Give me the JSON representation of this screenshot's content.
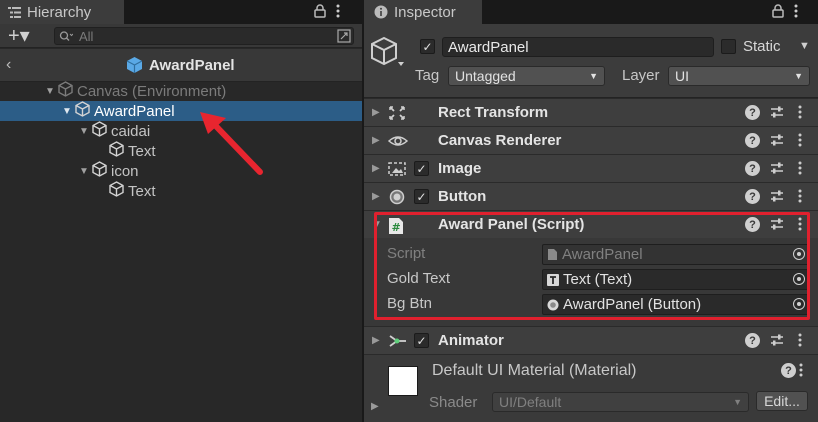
{
  "hierarchy": {
    "tab_label": "Hierarchy",
    "add_label": "+▾",
    "search_placeholder": "All",
    "breadcrumb_title": "AwardPanel",
    "tree": [
      {
        "label": "Canvas (Environment)",
        "indent": 0,
        "dim": true,
        "expanded": true,
        "selected": false
      },
      {
        "label": "AwardPanel",
        "indent": 1,
        "dim": false,
        "expanded": true,
        "selected": true
      },
      {
        "label": "caidai",
        "indent": 2,
        "dim": false,
        "expanded": true,
        "selected": false
      },
      {
        "label": "Text",
        "indent": 3,
        "dim": false,
        "expanded": null,
        "selected": false
      },
      {
        "label": "icon",
        "indent": 2,
        "dim": false,
        "expanded": true,
        "selected": false
      },
      {
        "label": "Text",
        "indent": 3,
        "dim": false,
        "expanded": null,
        "selected": false
      }
    ]
  },
  "inspector": {
    "tab_label": "Inspector",
    "object_name": "AwardPanel",
    "static_label": "Static",
    "tag_label": "Tag",
    "tag_value": "Untagged",
    "layer_label": "Layer",
    "layer_value": "UI",
    "components": [
      {
        "title": "Rect Transform",
        "icon": "rect-transform-icon",
        "has_checkbox": false
      },
      {
        "title": "Canvas Renderer",
        "icon": "eye-icon",
        "has_checkbox": false
      },
      {
        "title": "Image",
        "icon": "image-icon",
        "has_checkbox": true
      },
      {
        "title": "Button",
        "icon": "button-icon",
        "has_checkbox": true
      },
      {
        "title": "Award Panel (Script)",
        "icon": "script-icon",
        "has_checkbox": false
      },
      {
        "title": "Animator",
        "icon": "animator-icon",
        "has_checkbox": true
      }
    ],
    "script_props": [
      {
        "label": "Script",
        "value": "AwardPanel",
        "disabled": true,
        "icon": "script-file-icon"
      },
      {
        "label": "Gold Text",
        "value": "Text (Text)",
        "disabled": false,
        "icon": "text-component-icon"
      },
      {
        "label": "Bg Btn",
        "value": "AwardPanel (Button)",
        "disabled": false,
        "icon": "button-component-icon"
      }
    ],
    "material": {
      "title": "Default UI Material (Material)",
      "shader_label": "Shader",
      "shader_value": "UI/Default",
      "edit_label": "Edit..."
    }
  },
  "colors": {
    "selection": "#2c5d87",
    "highlight_box": "#e0202e",
    "arrow": "#e8252f"
  }
}
